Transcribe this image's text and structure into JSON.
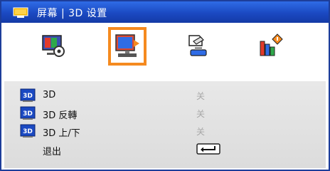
{
  "title": {
    "text": "屏幕 | 3D 设置",
    "icon": "screen-menu-icon"
  },
  "tabs": [
    {
      "icon": "image-settings-icon",
      "selected": false
    },
    {
      "icon": "display-settings-icon",
      "selected": true
    },
    {
      "icon": "setup-icon",
      "selected": false
    },
    {
      "icon": "options-icon",
      "selected": false
    }
  ],
  "rows": [
    {
      "icon": "3d-icon",
      "label": "3D",
      "value": "关"
    },
    {
      "icon": "3d-icon",
      "label": "3D 反轉",
      "value": "关"
    },
    {
      "icon": "3d-icon",
      "label": "3D 上/下",
      "value": "关"
    },
    {
      "label": "退出",
      "icon": "enter-key-icon"
    }
  ],
  "colors": {
    "title_bar": "#1b49c2",
    "highlight": "#f58a1f",
    "menu_bg": "#e0e0e0",
    "value_text": "#a8a8a8"
  }
}
